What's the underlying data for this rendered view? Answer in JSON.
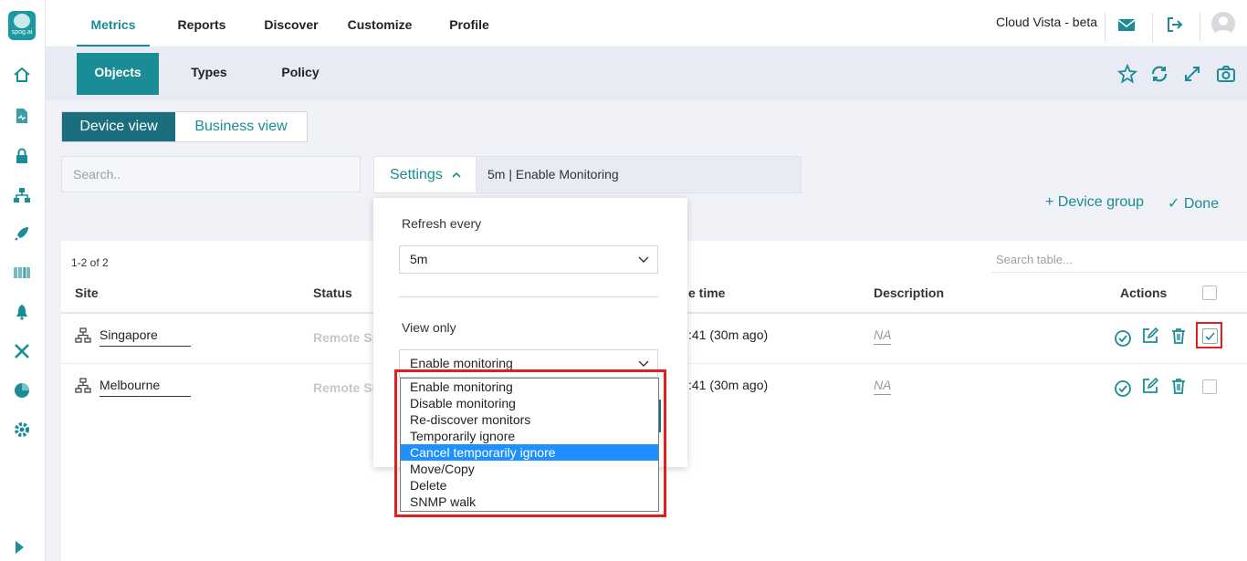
{
  "app": {
    "brand": "Cloud Vista - beta",
    "logo_text": "spog.ai"
  },
  "top_tabs": [
    {
      "label": "Metrics"
    },
    {
      "label": "Reports"
    },
    {
      "label": "Discover"
    },
    {
      "label": "Customize"
    },
    {
      "label": "Profile"
    }
  ],
  "sub_tabs": [
    {
      "label": "Objects"
    },
    {
      "label": "Types"
    },
    {
      "label": "Policy"
    }
  ],
  "view_toggle": {
    "device": "Device view",
    "business": "Business view"
  },
  "search": {
    "placeholder": "Search.."
  },
  "settings": {
    "label": "Settings",
    "value": "5m | Enable Monitoring"
  },
  "actions": {
    "device_group": "+ Device group",
    "done": "✓ Done"
  },
  "table": {
    "count": "1-2 of 2",
    "search_placeholder": "Search table...",
    "headers": {
      "site": "Site",
      "status": "Status",
      "time": "e time",
      "description": "Description",
      "actions": "Actions"
    },
    "rows": [
      {
        "site": "Singapore",
        "status": "Remote Sit",
        "time": ":41 (30m ago)",
        "description": "NA",
        "checked": true
      },
      {
        "site": "Melbourne",
        "status": "Remote Sit",
        "time": ":41 (30m ago)",
        "description": "NA",
        "checked": false
      }
    ]
  },
  "panel": {
    "refresh_label": "Refresh every",
    "refresh_value": "5m",
    "view_only_label": "View only",
    "view_only_value": "Enable monitoring",
    "options": [
      "Enable monitoring",
      "Disable monitoring",
      "Re-discover monitors",
      "Temporarily ignore",
      "Cancel temporarily ignore",
      "Move/Copy",
      "Delete",
      "SNMP walk"
    ],
    "highlighted_option": "Cancel temporarily ignore"
  },
  "colors": {
    "accent": "#1a8c95",
    "dark_accent": "#1a6e7d",
    "highlight": "#1e90ff",
    "annotation": "#e02020"
  }
}
